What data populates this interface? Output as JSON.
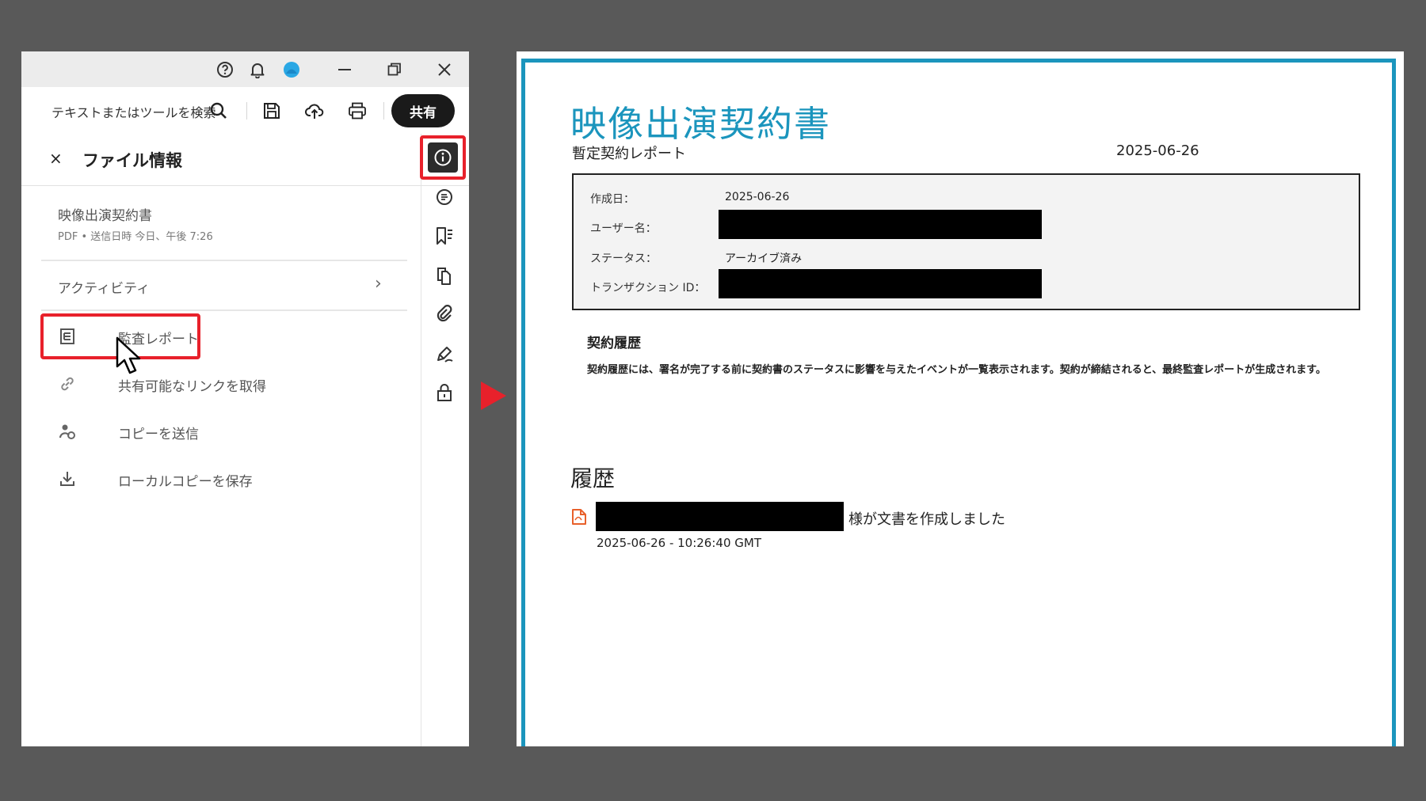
{
  "app": {
    "toolbar": {
      "search_placeholder": "テキストまたはツールを検索",
      "share_label": "共有"
    },
    "panel": {
      "close_glyph": "×",
      "title": "ファイル情報",
      "document_name": "映像出演契約書",
      "document_meta": "PDF  •  送信日時 今日、午後 7:26",
      "activity_label": "アクティビティ",
      "activity_chevron": "›",
      "menu": [
        {
          "label": "監査レポート",
          "icon": "report-icon"
        },
        {
          "label": "共有可能なリンクを取得",
          "icon": "link-icon"
        },
        {
          "label": "コピーを送信",
          "icon": "send-copy-icon"
        },
        {
          "label": "ローカルコピーを保存",
          "icon": "download-icon"
        }
      ]
    },
    "colors": {
      "highlight": "#e8212b",
      "accent_user": "#2aa7e4"
    }
  },
  "document": {
    "title": "映像出演契約書",
    "subtitle": "暫定契約レポート",
    "date": "2025-06-26",
    "info": {
      "created_label": "作成日：",
      "created_value": "2025-06-26",
      "user_label": "ユーザー名：",
      "status_label": "ステータス：",
      "status_value": "アーカイブ済み",
      "transaction_label": "トランザクション ID："
    },
    "contract_history_heading": "契約履歴",
    "contract_history_body": "契約履歴には、署名が完了する前に契約書のステータスに影響を与えたイベントが一覧表示されます。契約が締結されると、最終監査レポートが生成されます。",
    "history_heading": "履歴",
    "history_event_text": "様が文書を作成しました",
    "history_event_time": "2025-06-26 - 10:26:40 GMT",
    "colors": {
      "accent": "#1b95bd"
    }
  }
}
